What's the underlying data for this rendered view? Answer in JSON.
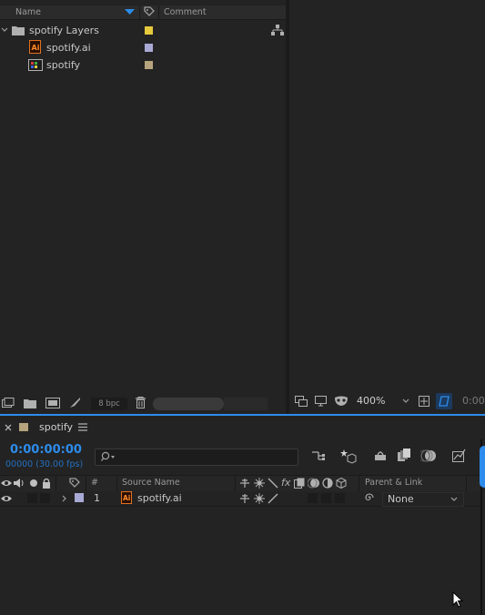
{
  "project": {
    "columns": {
      "name": "Name",
      "comment": "Comment"
    },
    "items": [
      {
        "label": "spotify Layers",
        "type": "folder",
        "color": "#e6c93c"
      },
      {
        "label": "spotify.ai",
        "type": "ai-file",
        "color": "#a9a9d6"
      },
      {
        "label": "spotify",
        "type": "composition",
        "color": "#b6a47c"
      }
    ],
    "bpc": "8 bpc"
  },
  "viewer": {
    "zoom": "400%",
    "timecode": "0:00:"
  },
  "timeline": {
    "tab_title": "spotify",
    "timecode": "0:00:00:00",
    "fps": "00000 (30.00 fps)",
    "columns": {
      "number": "#",
      "source_name": "Source Name",
      "parent_link": "Parent & Link"
    },
    "layers": [
      {
        "index": "1",
        "name": "spotify.ai",
        "parent": "None",
        "color": "#a9a9d6"
      }
    ]
  },
  "colors": {
    "accent": "#2d8ceb"
  }
}
